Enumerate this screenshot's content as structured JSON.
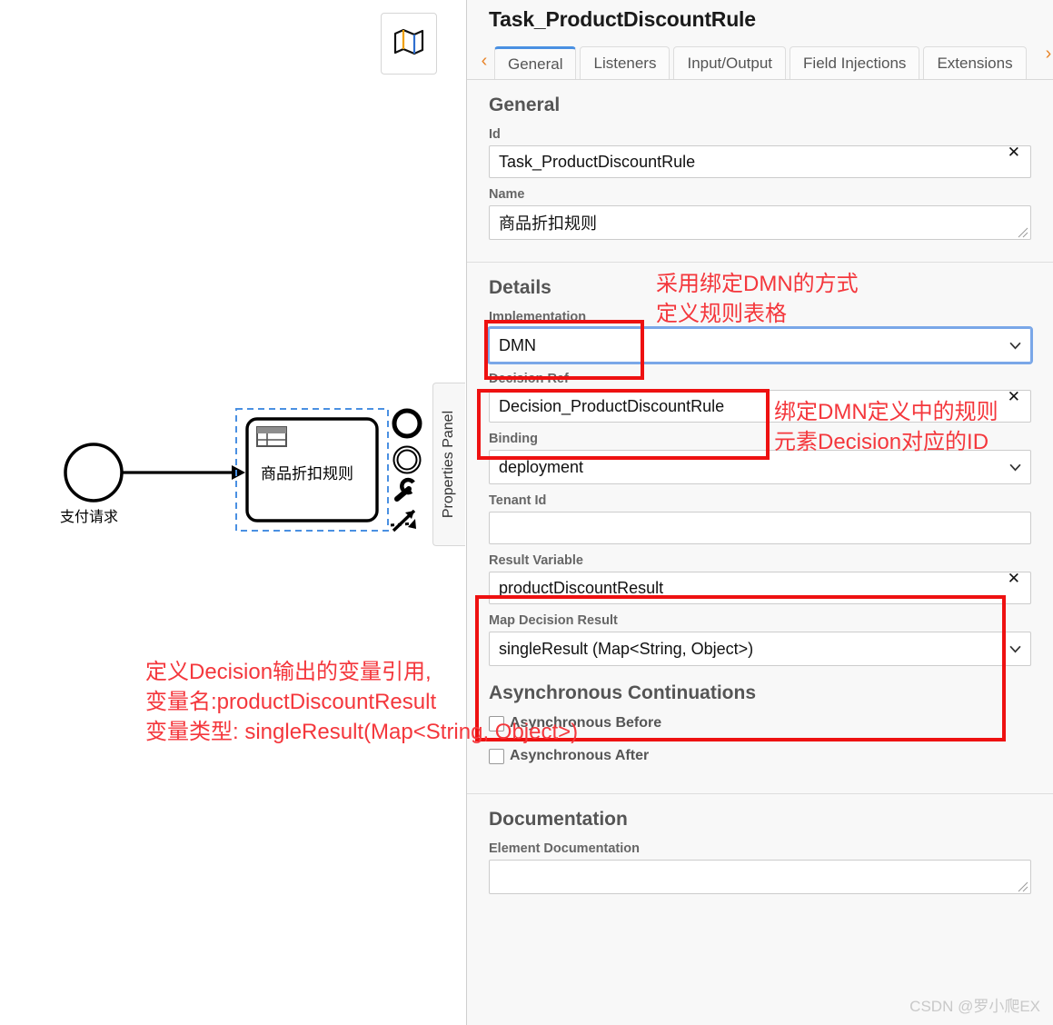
{
  "canvas": {
    "minimap_button": {
      "icon": "map-icon",
      "label": ""
    },
    "panel_tab_label": "Properties Panel",
    "diagram": {
      "start_event": {
        "label": "支付请求",
        "type": "start-event"
      },
      "business_rule_task": {
        "label": "商品折扣规则",
        "type": "business-rule-task",
        "selected": true,
        "icon": "business-rule-table-icon"
      },
      "context_pad": [
        {
          "name": "append-end-event-icon"
        },
        {
          "name": "append-intermediate-event-icon"
        },
        {
          "name": "wrench-change-type-icon"
        },
        {
          "name": "append-connection-icon"
        }
      ]
    }
  },
  "panel": {
    "title": "Task_ProductDiscountRule",
    "tabs": [
      {
        "label": "General",
        "active": true
      },
      {
        "label": "Listeners",
        "active": false
      },
      {
        "label": "Input/Output",
        "active": false
      },
      {
        "label": "Field Injections",
        "active": false
      },
      {
        "label": "Extensions",
        "active": false
      }
    ],
    "tab_scroll_left": "‹",
    "tab_scroll_right": "›",
    "sections": {
      "general": {
        "title": "General",
        "id": {
          "label": "Id",
          "value": "Task_ProductDiscountRule",
          "clear": "✕"
        },
        "name": {
          "label": "Name",
          "value": "商品折扣规则"
        }
      },
      "details": {
        "title": "Details",
        "implementation": {
          "label": "Implementation",
          "value": "DMN"
        },
        "decision_ref": {
          "label": "Decision Ref",
          "value": "Decision_ProductDiscountRule",
          "clear": "✕"
        },
        "binding": {
          "label": "Binding",
          "value": "deployment"
        },
        "tenant_id": {
          "label": "Tenant Id",
          "value": ""
        },
        "result_variable": {
          "label": "Result Variable",
          "value": "productDiscountResult",
          "clear": "✕"
        },
        "map_decision_result": {
          "label": "Map Decision Result",
          "value": "singleResult (Map<String, Object>)"
        }
      },
      "async": {
        "title": "Asynchronous Continuations",
        "async_before": {
          "label": "Asynchronous Before",
          "checked": false
        },
        "async_after": {
          "label": "Asynchronous After",
          "checked": false
        }
      },
      "documentation": {
        "title": "Documentation",
        "element_documentation": {
          "label": "Element Documentation",
          "value": ""
        }
      }
    }
  },
  "annotations": {
    "impl_note_line1": "采用绑定DMN的方式",
    "impl_note_line2": "定义规则表格",
    "decision_note_line1": "绑定DMN定义中的规则",
    "decision_note_line2": "元素Decision对应的ID",
    "result_note_line1": "定义Decision输出的变量引用,",
    "result_note_line2": "变量名:productDiscountResult",
    "result_note_line3": "变量类型: singleResult(Map<String, Object>)"
  },
  "watermark": "CSDN @罗小爬EX",
  "colors": {
    "accent": "#4a90e2",
    "annotation_red": "#f4373c",
    "box_red": "#ee1111"
  }
}
